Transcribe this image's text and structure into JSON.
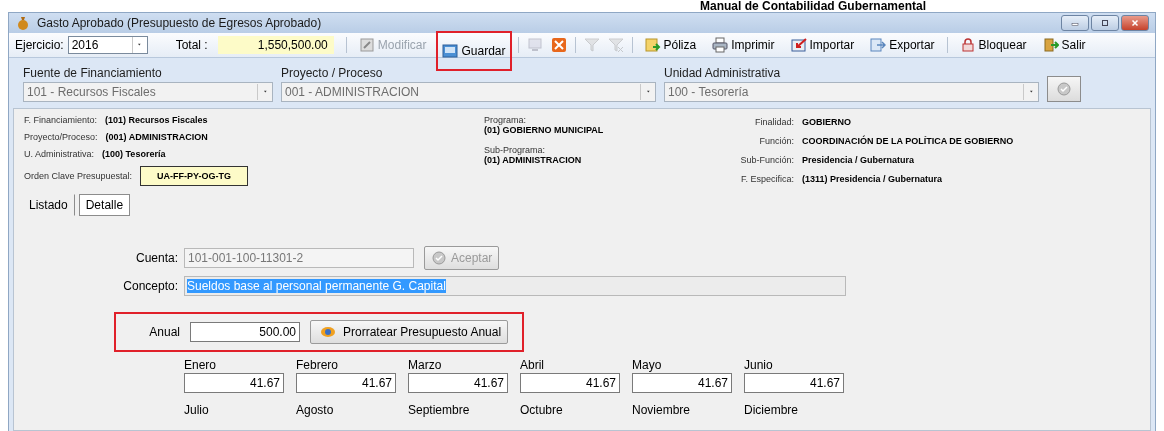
{
  "doc_title": "Manual de Contabilidad Gubernamental",
  "window": {
    "title": "Gasto Aprobado (Presupuesto de Egresos Aprobado)"
  },
  "toolbar": {
    "ejercicio_label": "Ejercicio:",
    "ejercicio": "2016",
    "total_label": "Total :",
    "total": "1,550,500.00",
    "items": [
      {
        "kind": "button",
        "label": "Modificar",
        "disabled": true,
        "highlighted": false
      },
      {
        "kind": "button",
        "label": "Guardar",
        "disabled": false,
        "highlighted": true
      },
      {
        "kind": "separator"
      },
      {
        "kind": "icon",
        "disabled": true
      },
      {
        "kind": "icon",
        "disabled": false
      },
      {
        "kind": "separator"
      },
      {
        "kind": "icon",
        "disabled": true
      },
      {
        "kind": "icon",
        "disabled": true
      },
      {
        "kind": "separator"
      },
      {
        "kind": "button",
        "label": "Póliza",
        "disabled": false,
        "highlighted": false
      },
      {
        "kind": "button",
        "label": "Imprimir",
        "disabled": false,
        "highlighted": false
      },
      {
        "kind": "button",
        "label": "Importar",
        "disabled": false,
        "highlighted": false
      },
      {
        "kind": "button",
        "label": "Exportar",
        "disabled": false,
        "highlighted": false
      },
      {
        "kind": "separator"
      },
      {
        "kind": "button",
        "label": "Bloquear",
        "disabled": false,
        "highlighted": false
      },
      {
        "kind": "button",
        "label": "Salir",
        "disabled": false,
        "highlighted": false
      }
    ]
  },
  "filters": [
    {
      "label": "Fuente de Financiamiento",
      "value": "101 - Recursos Fiscales",
      "disabled": true
    },
    {
      "label": "Proyecto / Proceso",
      "value": "001 - ADMINISTRACION",
      "disabled": true
    },
    {
      "label": "Unidad Administrativa",
      "value": "100 - Tesorería",
      "disabled": true
    }
  ],
  "info": {
    "left": [
      {
        "label": "F. Financiamiento:",
        "value": "(101) Recursos Fiscales"
      },
      {
        "label": "Proyecto/Proceso:",
        "value": "(001) ADMINISTRACION"
      },
      {
        "label": "U. Administrativa:",
        "value": "(100) Tesorería"
      }
    ],
    "clave": {
      "label": "Orden Clave Presupuestal:",
      "value": "UA-FF-PY-OG-TG"
    },
    "middle": [
      {
        "label": "Programa:",
        "value": "(01) GOBIERNO MUNICIPAL"
      },
      {
        "label": "Sub-Programa:",
        "value": "(01) ADMINISTRACION"
      }
    ],
    "right": [
      {
        "label": "Finalidad:",
        "value": "GOBIERNO"
      },
      {
        "label": "Función:",
        "value": "COORDINACIÓN DE LA POLÍTICA DE GOBIERNO"
      },
      {
        "label": "Sub-Función:",
        "value": "Presidencia / Gubernatura"
      },
      {
        "label": "F. Especifica:",
        "value": "(1311) Presidencia / Gubernatura"
      }
    ]
  },
  "tabs": [
    {
      "label": "Listado",
      "selected": false
    },
    {
      "label": "Detalle",
      "selected": true
    }
  ],
  "detail": {
    "cuenta": {
      "label": "Cuenta:",
      "value": "101-001-100-11301-2",
      "disabled": true
    },
    "aceptar": {
      "label": "Aceptar",
      "disabled": true
    },
    "concepto": {
      "label": "Concepto:",
      "value": "Sueldos base al personal permanente G. Capital",
      "selected": true
    },
    "anual": {
      "label": "Anual",
      "value": "500.00",
      "highlighted": true
    },
    "prorratear": {
      "label": "Prorratear Presupuesto Anual"
    },
    "months": [
      {
        "label": "Enero",
        "value": "41.67"
      },
      {
        "label": "Febrero",
        "value": "41.67"
      },
      {
        "label": "Marzo",
        "value": "41.67"
      },
      {
        "label": "Abril",
        "value": "41.67"
      },
      {
        "label": "Mayo",
        "value": "41.67"
      },
      {
        "label": "Junio",
        "value": "41.67"
      }
    ],
    "months_next": [
      {
        "label": "Julio"
      },
      {
        "label": "Agosto"
      },
      {
        "label": "Septiembre"
      },
      {
        "label": "Octubre"
      },
      {
        "label": "Noviembre"
      },
      {
        "label": "Diciembre"
      }
    ]
  }
}
